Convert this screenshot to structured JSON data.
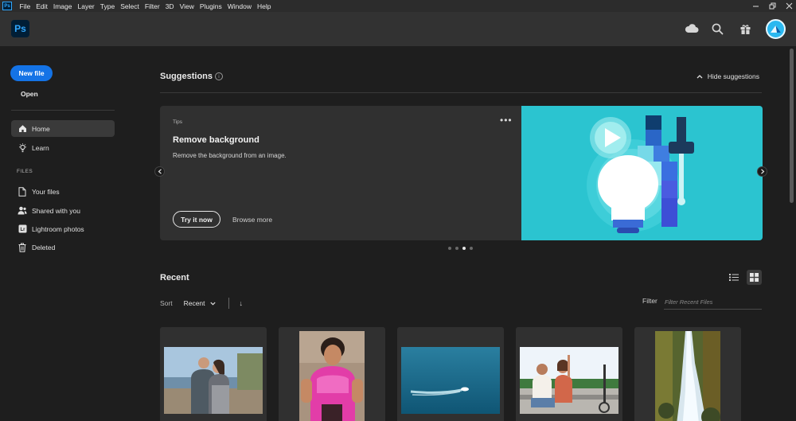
{
  "menubar": {
    "app_badge": "Ps",
    "items": [
      "File",
      "Edit",
      "Image",
      "Layer",
      "Type",
      "Select",
      "Filter",
      "3D",
      "View",
      "Plugins",
      "Window",
      "Help"
    ]
  },
  "header": {
    "logo": "Ps",
    "icons": [
      "cloud-icon",
      "search-icon",
      "gift-icon",
      "avatar"
    ]
  },
  "sidebar": {
    "new_file": "New file",
    "open": "Open",
    "nav": [
      {
        "label": "Home",
        "icon": "home-icon",
        "active": true
      },
      {
        "label": "Learn",
        "icon": "lightbulb-icon",
        "active": false
      }
    ],
    "files_section": "FILES",
    "files": [
      {
        "label": "Your files",
        "icon": "file-icon"
      },
      {
        "label": "Shared with you",
        "icon": "shared-user-icon"
      },
      {
        "label": "Lightroom photos",
        "icon": "lightroom-icon"
      },
      {
        "label": "Deleted",
        "icon": "trash-icon"
      }
    ]
  },
  "suggestions": {
    "title": "Suggestions",
    "hide": "Hide suggestions",
    "card": {
      "tag": "Tips",
      "title": "Remove background",
      "description": "Remove the background from an image.",
      "primary": "Try it now",
      "secondary": "Browse more"
    },
    "carousel": {
      "count": 4,
      "active_index": 2
    }
  },
  "recent": {
    "title": "Recent",
    "sort_label": "Sort",
    "sort_value": "Recent",
    "filter_label": "Filter",
    "filter_placeholder": "Filter Recent Files",
    "view_mode": "grid",
    "thumbnails": [
      "couple-lake-photo",
      "girl-pink-dress-photo",
      "speedboat-ocean-photo",
      "couple-selfie-photo",
      "waterfall-forest-photo"
    ]
  },
  "colors": {
    "accent": "#1473e6",
    "ps_blue": "#31a8ff",
    "card_art": "#2bc4d0",
    "background": "#1e1e1e"
  }
}
